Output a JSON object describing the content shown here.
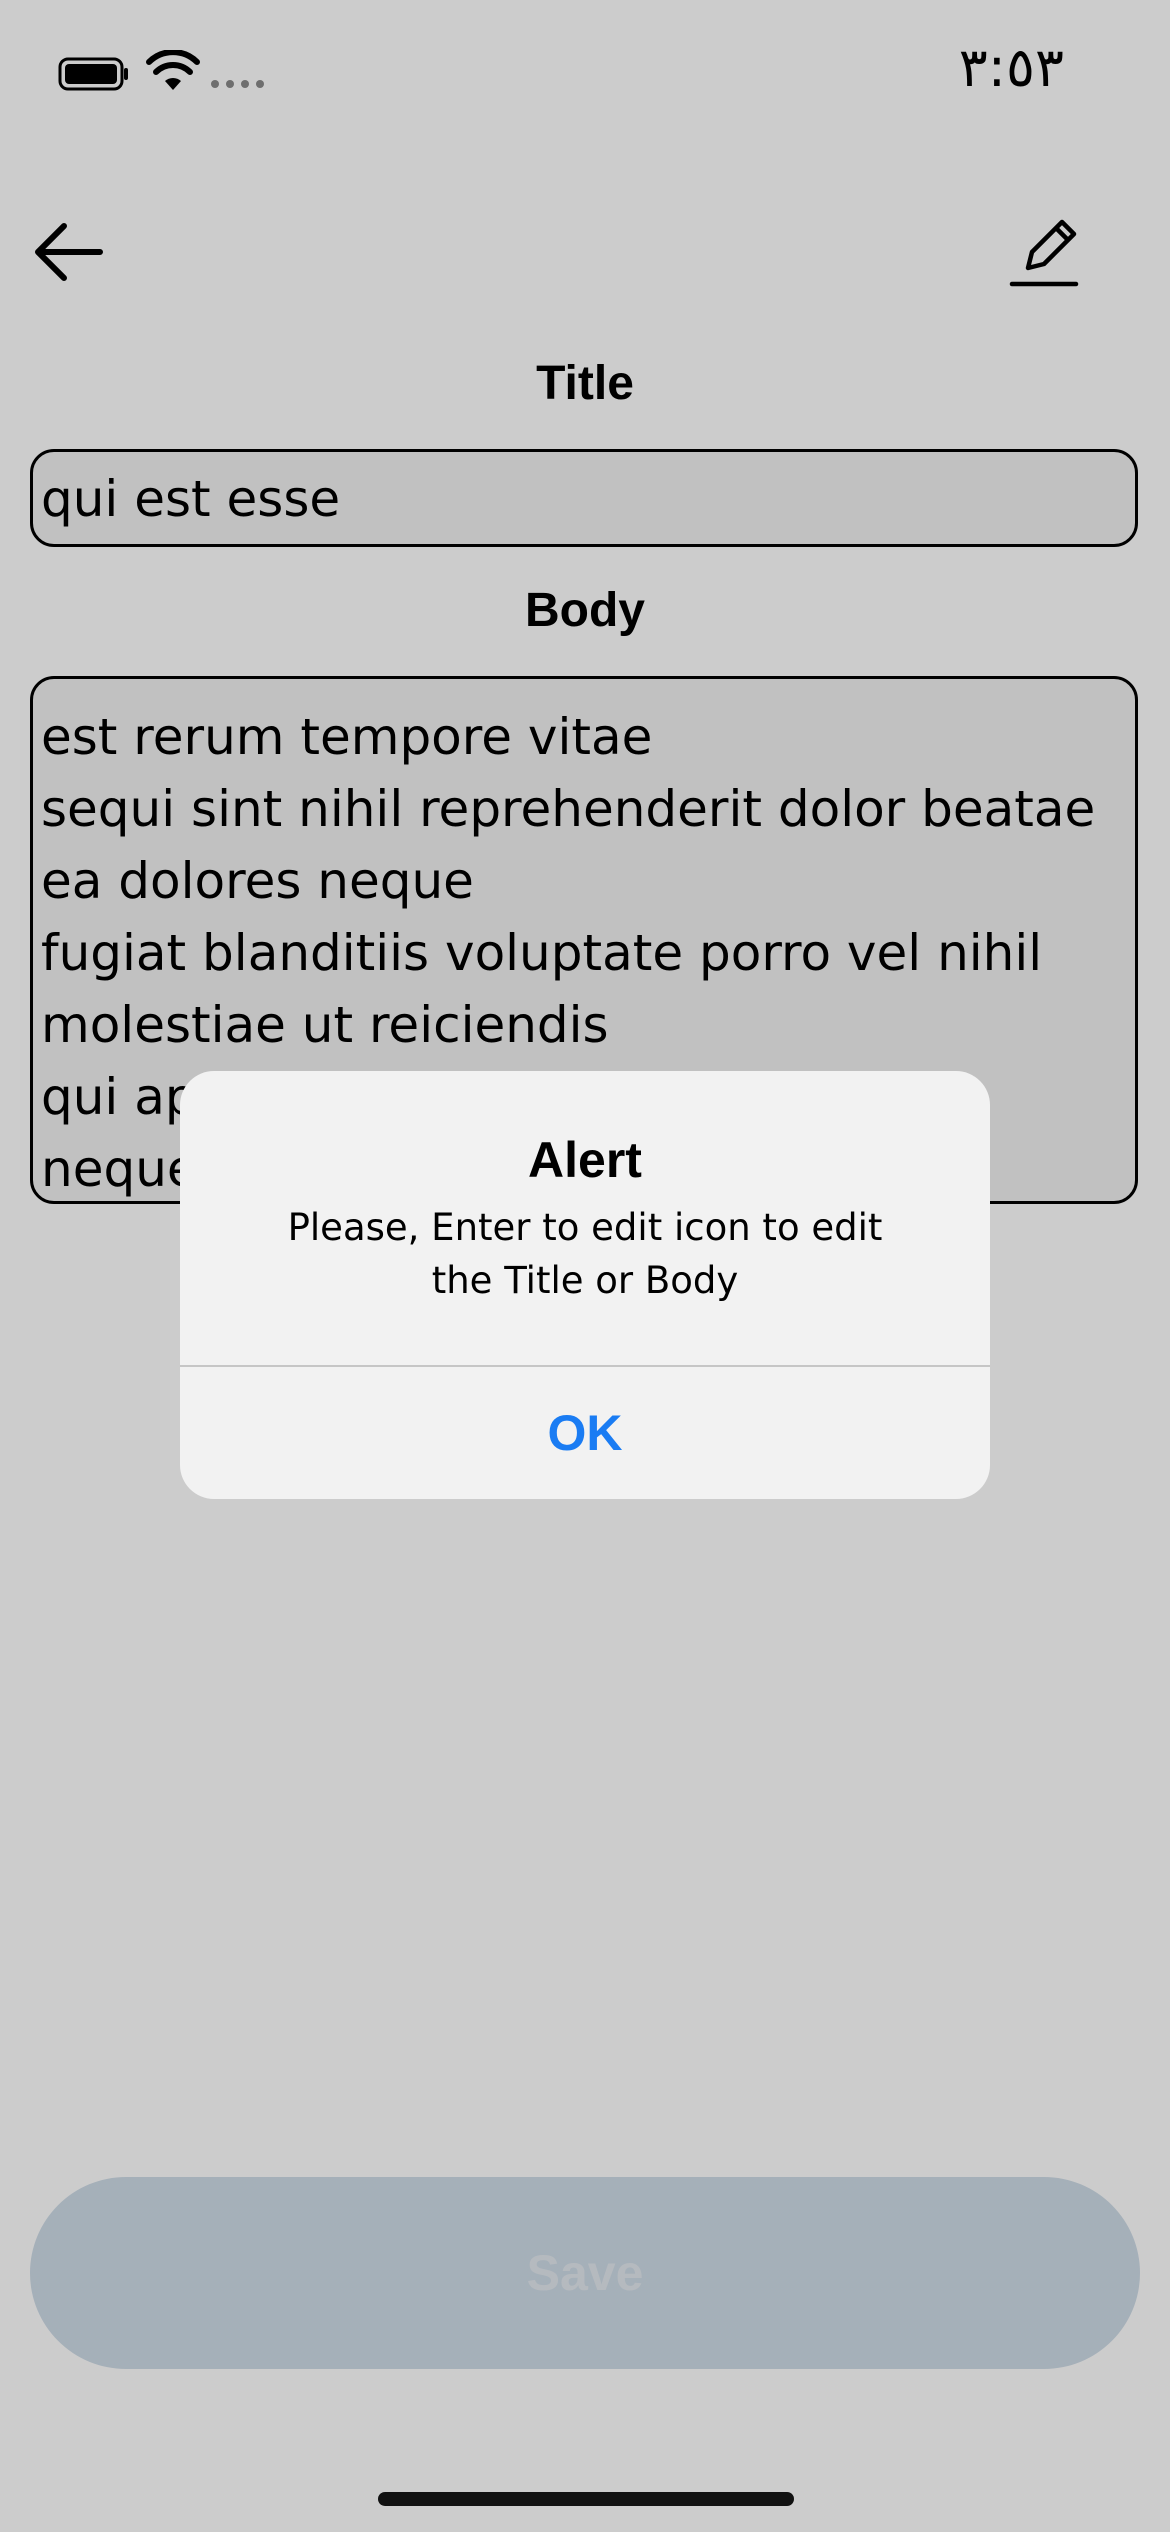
{
  "status_bar": {
    "time": "٣:٥٣",
    "icons": [
      "battery-icon",
      "wifi-icon",
      "signal-icon"
    ]
  },
  "top_bar": {
    "back_icon": "arrow-left-icon",
    "edit_icon": "pencil-icon"
  },
  "form": {
    "title_label": "Title",
    "title_value": "qui est esse",
    "body_label": "Body",
    "body_value": "est rerum tempore vitae\nsequi sint nihil reprehenderit dolor beatae ea dolores neque\nfugiat blanditiis voluptate porro vel nihil molestiae ut reiciendis\nqui aperiam non debitis possimus qui neque nisi nulla"
  },
  "save_button": {
    "label": "Save"
  },
  "alert": {
    "title": "Alert",
    "message": "Please, Enter to edit icon to edit the Title or Body",
    "ok_label": "OK"
  },
  "colors": {
    "accent": "#1a7cf3",
    "save_button_bg": "#cfdce8",
    "overlay": "rgba(0,0,0,0.20)"
  }
}
